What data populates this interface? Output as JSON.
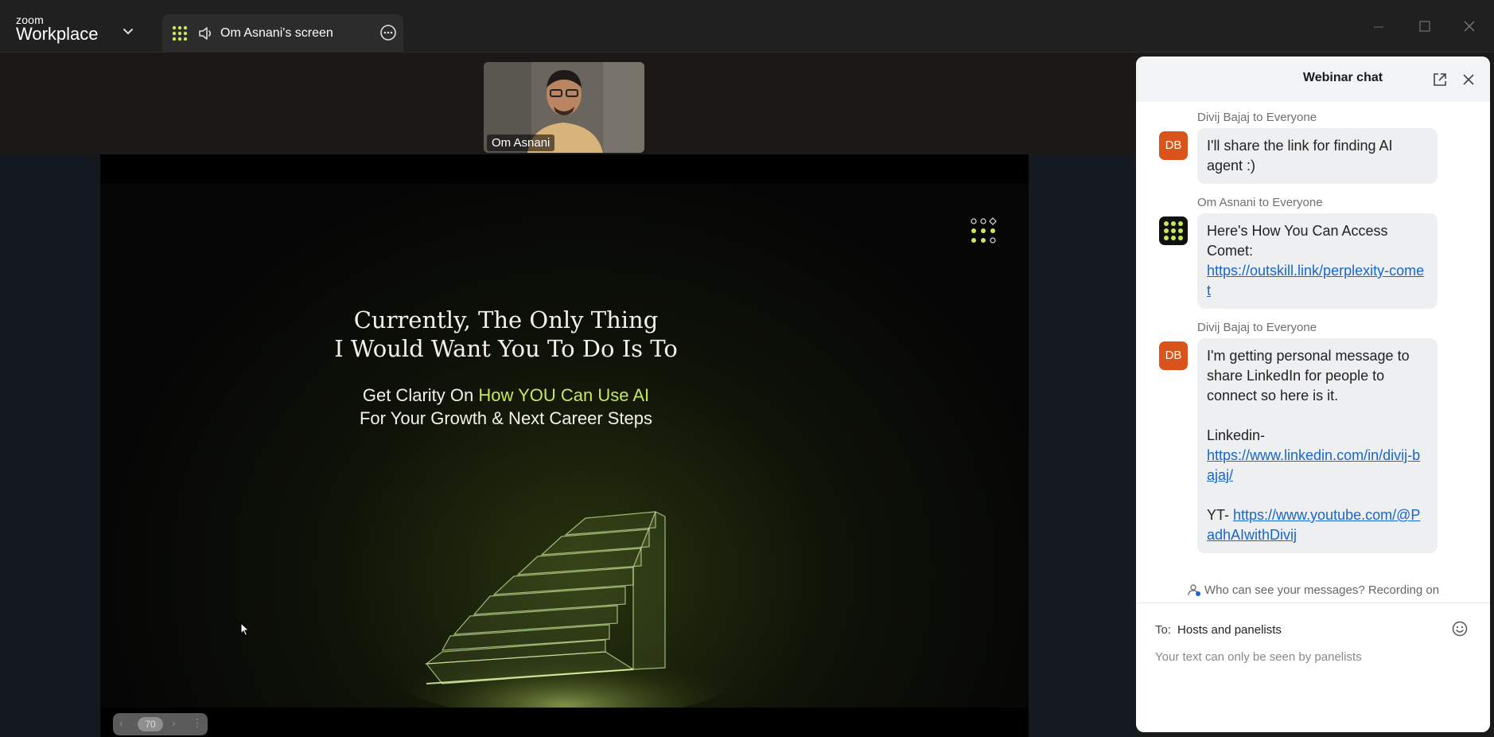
{
  "app": {
    "brand_top": "zoom",
    "brand_bottom": "Workplace",
    "tab_title": "Om Asnani's screen"
  },
  "video": {
    "participant_name": "Om Asnani"
  },
  "slide": {
    "headline_line1": "Currently, The Only Thing",
    "headline_line2": "I Would Want You To Do Is To",
    "sub_prefix": "Get Clarity On ",
    "sub_highlight": "How YOU Can Use AI",
    "sub_line2": "For Your Growth & Next Career Steps",
    "accent_color": "#c6e85a",
    "page_number": "70"
  },
  "chat": {
    "title": "Webinar chat",
    "messages": [
      {
        "sender": "Divij Bajaj to Everyone",
        "avatar": "DB",
        "text": "I'll share the link for finding AI agent :)"
      },
      {
        "sender": "Om Asnani to Everyone",
        "avatar": "",
        "text": "Here's How You Can Access Comet:",
        "link": "https://outskill.link/perplexity-comet"
      },
      {
        "sender": "Divij Bajaj to Everyone",
        "avatar": "DB",
        "text": "I'm getting personal message to share LinkedIn for people to connect so here is it.",
        "linkedin_label": "Linkedin-",
        "linkedin_link": "https://www.linkedin.com/in/divij-bajaj/",
        "yt_label": "YT- ",
        "yt_link": "https://www.youtube.com/@PadhAIwithDivij"
      }
    ],
    "privacy_notice": "Who can see your messages? Recording on",
    "to_label": "To:",
    "to_value": "Hosts and panelists",
    "input_placeholder": "Your text can only be seen by panelists"
  }
}
